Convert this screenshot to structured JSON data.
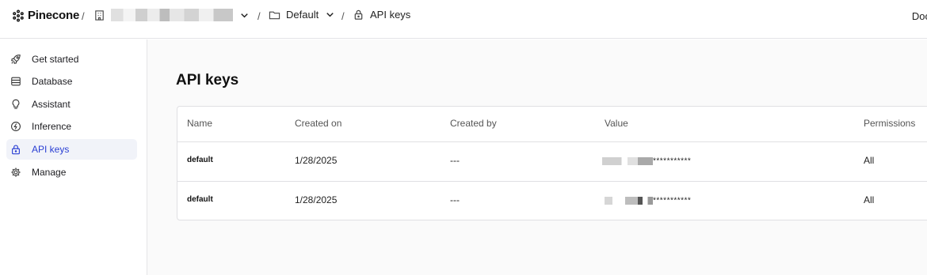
{
  "header": {
    "logo_text": "Pinecone",
    "separator": "/",
    "project_label": "Default",
    "page_label": "API keys",
    "docs_label": "Doc"
  },
  "sidebar": {
    "items": [
      {
        "label": "Get started",
        "icon": "rocket-icon"
      },
      {
        "label": "Database",
        "icon": "database-icon"
      },
      {
        "label": "Assistant",
        "icon": "lightbulb-icon"
      },
      {
        "label": "Inference",
        "icon": "inference-icon"
      },
      {
        "label": "API keys",
        "icon": "lock-icon",
        "active": true
      },
      {
        "label": "Manage",
        "icon": "gear-icon"
      }
    ]
  },
  "main": {
    "title": "API keys",
    "table": {
      "columns": [
        "Name",
        "Created on",
        "Created by",
        "Value",
        "Permissions"
      ],
      "rows": [
        {
          "name": "default",
          "created_on": "1/28/2025",
          "created_by": "---",
          "value_suffix": "***********",
          "permissions": "All"
        },
        {
          "name": "default",
          "created_on": "1/28/2025",
          "created_by": "---",
          "value_suffix": "***********",
          "permissions": "All"
        }
      ]
    }
  },
  "colors": {
    "accent": "#2a3fd4",
    "active_bg": "#f1f3f9",
    "border": "#e0e0e3"
  }
}
